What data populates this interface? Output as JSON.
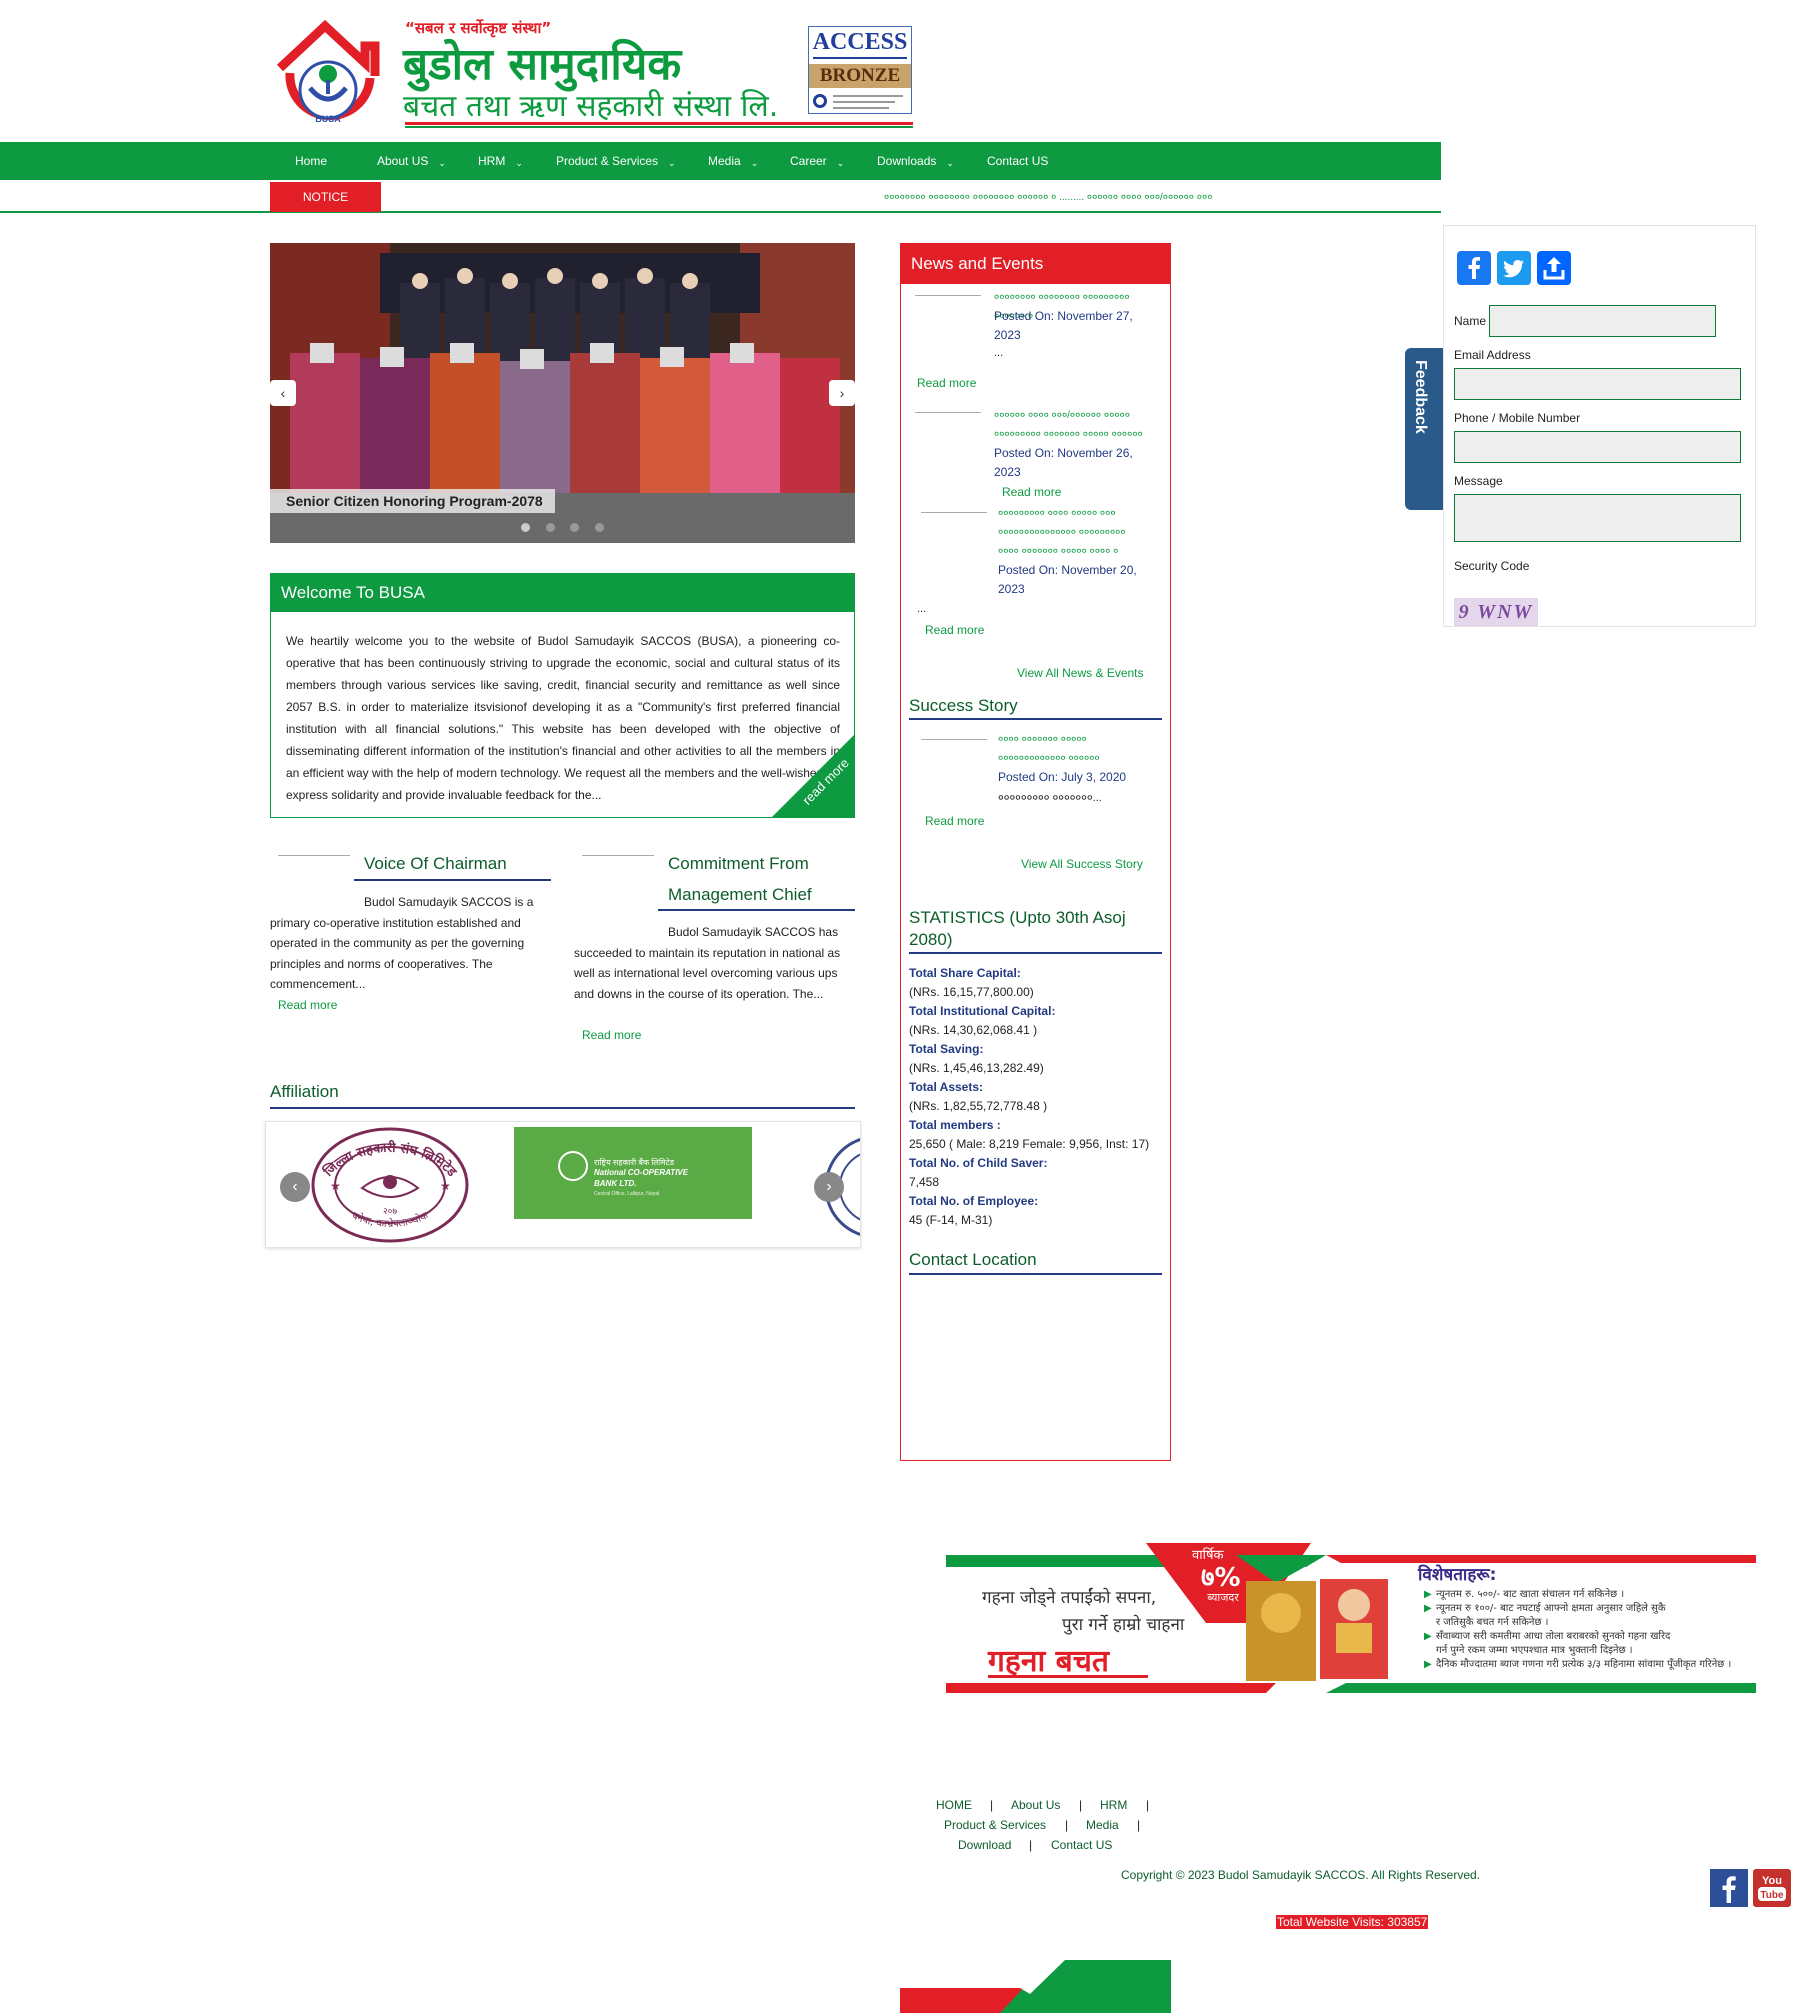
{
  "header": {
    "slogan": "“सबल र सर्वोत्कृष्ट संस्था”",
    "name_line1": "बुडोल सामुदायिक",
    "name_line2": "बचत तथा ऋण सहकारी संस्था लि.",
    "logo_abbr": "BUSA",
    "badge_title": "ACCESS",
    "badge_level": "BRONZE"
  },
  "nav": {
    "items": [
      "Home",
      "About US",
      "HRM",
      "Product & Services",
      "Media",
      "Career",
      "Downloads",
      "Contact US"
    ]
  },
  "notice": {
    "label": "NOTICE",
    "ticker": "०००००००० ०००००००० ०००००००० ०००००० ० ......... ०००००० ०००० ०००/०००००० ०००"
  },
  "slider": {
    "caption": "Senior Citizen Honoring Program-2078",
    "prev": "‹",
    "next": "›"
  },
  "welcome": {
    "heading": "Welcome To BUSA",
    "text": "We heartily welcome you to the website of Budol Samudayik SACCOS (BUSA), a pioneering co-operative that has been continuously striving to upgrade the economic, social and cultural status of its members through various services like saving, credit, financial security and remittance as well since 2057 B.S. in order to materialize itsvisionof developing it as a \"Community's first preferred financial institution with all financial solutions.\" This website has been developed with the objective of disseminating different information of the institution's financial and other activities to all the members in an efficient way with the help of modern technology. We request all the members and the well-wishers to express solidarity and provide invaluable feedback for the...",
    "read_more": "read more"
  },
  "chairman": {
    "title": "Voice Of Chairman",
    "text": "Budol Samudayik SACCOS is a primary co-operative institution established and operated in the community as per the governing principles and norms of cooperatives. The commencement...",
    "read_more": "Read more"
  },
  "commitment": {
    "title_line1": "Commitment From",
    "title_line2": "Management Chief",
    "text": "Budol Samudayik SACCOS has succeeded to maintain its reputation in national as well as international level overcoming various ups and downs in the course of its operation. The...",
    "read_more": "Read more"
  },
  "affiliation": {
    "title": "Affiliation",
    "logo1_ring_text": "जिल्ला सहकारी संघ लिमिटेड",
    "logo1_bottom_text": "बनेपा, काभ्रेपलाञ्चोक",
    "logo1_year": "२०७",
    "logo2_line1": "राष्ट्रिय सहकारी बैंक लिमिटेड",
    "logo2_line2": "National CO-OPERATIVE BANK LTD.",
    "logo2_line3": "Central Office, Lalitpur, Nepal",
    "prev": "‹",
    "next": "›"
  },
  "news": {
    "heading": "News and Events",
    "items": [
      {
        "title": "०००००००० ०००००००० ००००००००० ०००००० ०",
        "date": "Posted On: November 27, 2023",
        "excerpt": "...",
        "read_more": "Read more"
      },
      {
        "title": "०००००० ०००० ०००/०००००० ००००० ००००००००० ००००००० ००००० ००००००",
        "date": "Posted On: November 26, 2023",
        "excerpt": "",
        "read_more": "Read more"
      },
      {
        "title": "००००००००० ०००० ००००० ००० ००००००००००००००० ००००००००० ०००० ००००००० ००००० ०००० ०",
        "date": "Posted On: November 20, 2023",
        "excerpt": "...",
        "read_more": "Read more"
      }
    ],
    "view_all": "View All News & Events"
  },
  "success": {
    "heading": "Success Story",
    "title": "०००० ००००००० ००००० ००००००००००००० ००००००",
    "date": "Posted On: July 3, 2020",
    "excerpt": "००००००००० ०००००००...",
    "read_more": "Read more",
    "view_all": "View All Success Story"
  },
  "statistics": {
    "heading": "STATISTICS (Upto 30th Asoj 2080)",
    "items": [
      {
        "label": "Total Share Capital:",
        "value": "(NRs. 16,15,77,800.00)"
      },
      {
        "label": "Total Institutional Capital:",
        "value": "(NRs. 14,30,62,068.41 )"
      },
      {
        "label": "Total Saving:",
        "value": "(NRs. 1,45,46,13,282.49)"
      },
      {
        "label": "Total Assets:",
        "value": "(NRs. 1,82,55,72,778.48 )"
      },
      {
        "label": "Total members :",
        "value": "25,650 ( Male: 8,219 Female: 9,956, Inst: 17)"
      },
      {
        "label": "Total No. of Child Saver:",
        "value": "7,458"
      },
      {
        "label": "Total No. of Employee:",
        "value": "45 (F-14, M-31)"
      }
    ]
  },
  "contact_location": {
    "heading": "Contact Location"
  },
  "feedback": {
    "tab": "Feedback",
    "name_label": "Name",
    "email_label": "Email Address",
    "phone_label": "Phone / Mobile Number",
    "message_label": "Message",
    "security_label": "Security Code",
    "captcha": "9 WNW"
  },
  "banner": {
    "tagline1": "गहना जोड्ने तपाईंको सपना,",
    "tagline2": "पुरा गर्ने हाम्रो चाहना",
    "product": "गहना बचत",
    "rate_label": "वार्षिक",
    "rate_value": "७%",
    "rate_suffix": "ब्याजदर",
    "features_title": "विशेषताहरू:",
    "features": [
      "न्यूनतम रु. ५००/- बाट खाता संचालन गर्न सकिनेछ ।",
      "न्यूनतम रु १००/- बाट नघटाई आफ्नो क्षमता अनुसार जहिले सुकै",
      "र जतिसुकै बचत गर्न सकिनेछ ।",
      "सँवाब्याज सरी कमतीमा आधा तोला बराबरको सुनको गहना खरिद",
      "गर्न पुग्ने रकम जम्मा भएपश्चात मात्र भुक्तानी दिइनेछ ।",
      "दैनिक मौज्दातमा ब्याज गणना गरी प्रत्येक ३/३ महिनामा सांवामा पूँजीकृत गरिनेछ ।"
    ]
  },
  "footer": {
    "links": [
      "HOME",
      "About Us",
      "HRM",
      "Product & Services",
      "Media",
      "Download",
      "Contact US"
    ],
    "separator": "|",
    "copyright": "Copyright © 2023 Budol Samudayik SACCOS. All Rights Reserved.",
    "visits": "Total Website Visits: 303857",
    "youtube_you": "You",
    "youtube_tube": "Tube"
  },
  "colors": {
    "green": "#0d9a40",
    "red": "#e21e26",
    "navy": "#223a82"
  }
}
